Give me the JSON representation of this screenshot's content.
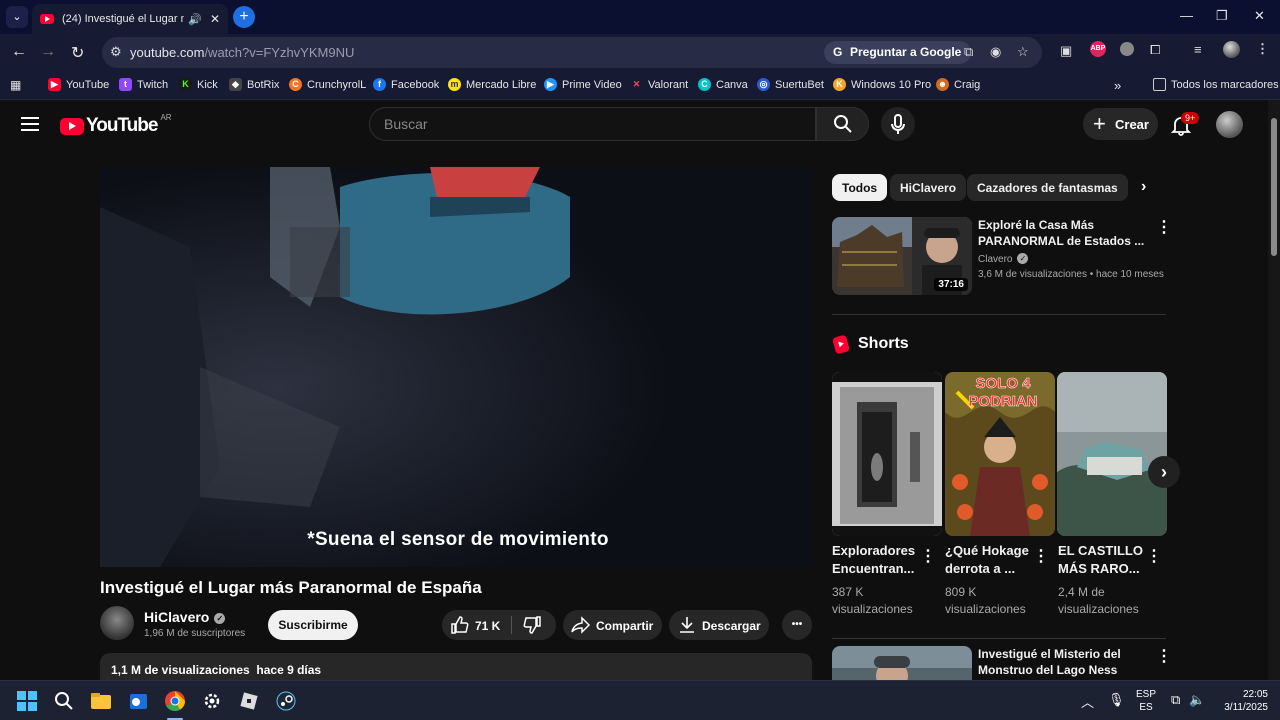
{
  "browser": {
    "tab": {
      "title": "(24) Investigué el Lugar má",
      "close": "✕",
      "new": "+"
    },
    "window": {
      "minimize": "—",
      "maximize": "❐",
      "close": "✕"
    },
    "url": {
      "host": "youtube.com",
      "path": "/watch?v=FYzhvYKM9NU"
    },
    "ask_google": "Preguntar a Google",
    "bookmarks": [
      "YouTube",
      "Twitch",
      "Kick",
      "BotRix",
      "CrunchyrolL",
      "Facebook",
      "Mercado Libre",
      "Prime Video",
      "Valorant",
      "Canva",
      "SuertuBet",
      "Windows 10 Pro",
      "Craig"
    ],
    "all_bookmarks": "Todos los marcadores"
  },
  "youtube": {
    "logo_text": "YouTube",
    "country": "AR",
    "search_placeholder": "Buscar",
    "create": "Crear",
    "notif_badge": "9+",
    "video": {
      "subtitle": "*Suena el sensor de movimiento",
      "title": "Investigué el Lugar más Paranormal de España",
      "channel": "HiClavero",
      "subs": "1,96 M de suscriptores",
      "subscribe": "Suscribirme",
      "likes": "71 K",
      "share": "Compartir",
      "download": "Descargar",
      "more": "•••",
      "desc_meta": "1,1 M de visualizaciones  hace 9 días"
    },
    "chips": [
      "Todos",
      "HiClavero",
      "Cazadores de fantasmas"
    ],
    "recs": [
      {
        "title": "Exploré la Casa Más PARANORMAL de Estados ...",
        "channel": "Clavero",
        "meta": "3,6 M de visualizaciones • hace 10 meses",
        "duration": "37:16"
      },
      {
        "title": "Investigué el Misterio del Monstruo del Lago Ness",
        "channel": "",
        "meta": "",
        "duration": ""
      }
    ],
    "shorts_label": "Shorts",
    "shorts": [
      {
        "title": "Exploradores Encuentran...",
        "views": "387 K visualizaciones"
      },
      {
        "title": "¿Qué Hokage derrota a ...",
        "views": "809 K visualizaciones"
      },
      {
        "title": "EL CASTILLO MÁS RARO...",
        "views": "2,4 M de visualizaciones"
      }
    ],
    "short2_overlay": "SOLO 4 PODRIAN"
  },
  "taskbar": {
    "lang1": "ESP",
    "lang2": "ES",
    "time": "22:05",
    "date": "3/11/2025"
  },
  "colors": {
    "yt_red": "#ff0033",
    "bg": "#0f0f0f",
    "chip_active": "#f1f1f1",
    "chip": "#272727"
  }
}
